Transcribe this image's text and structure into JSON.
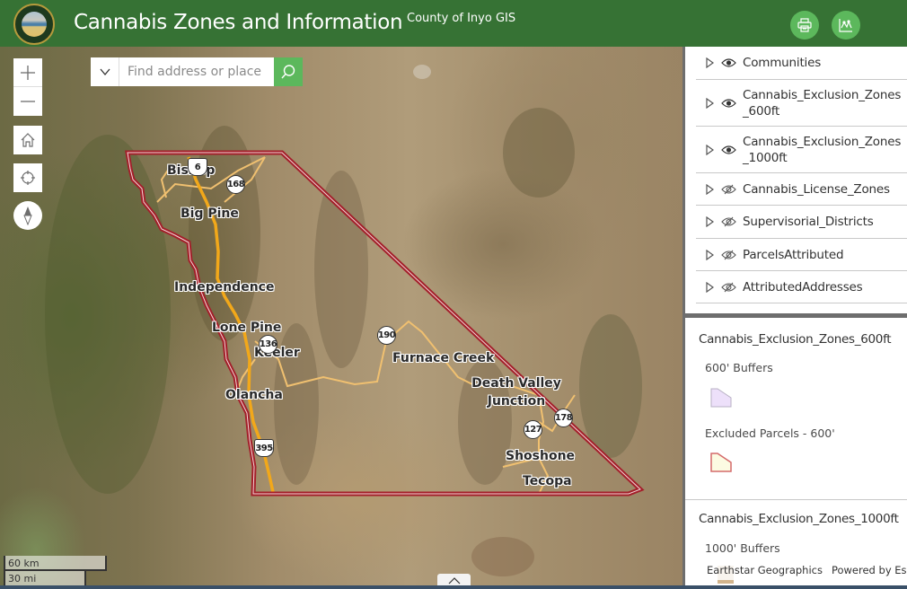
{
  "header": {
    "title": "Cannabis Zones and Information",
    "subtitle": "County of Inyo GIS",
    "logo_alt": "County of Inyo seal",
    "buttons": [
      {
        "name": "print",
        "icon": "printer-icon"
      },
      {
        "name": "chart",
        "icon": "line-chart-icon"
      }
    ],
    "color": "#367234",
    "button_color": "#5cb85c"
  },
  "search": {
    "placeholder": "Find address or place",
    "value": "",
    "dropdown_icon": "chevron-down-icon",
    "button_icon": "search-icon"
  },
  "map_controls": {
    "zoom_in": "+",
    "zoom_out": "−",
    "home_icon": "home-icon",
    "locate_icon": "crosshair-icon",
    "compass_icon": "compass-icon"
  },
  "map": {
    "basemap": "Imagery",
    "boundary_color": "#a31f2a",
    "highway_color": "#f2a81a",
    "road_color": "#f0c070",
    "places": [
      {
        "name": "Bishop"
      },
      {
        "name": "Big Pine"
      },
      {
        "name": "Independence"
      },
      {
        "name": "Lone Pine"
      },
      {
        "name": "Keeler"
      },
      {
        "name": "Olancha"
      },
      {
        "name": "Furnace Creek"
      },
      {
        "name": "Death Valley Junction"
      },
      {
        "name": "Shoshone"
      },
      {
        "name": "Tecopa"
      }
    ],
    "route_shields": [
      {
        "route": "6",
        "type": "us"
      },
      {
        "route": "168",
        "type": "state"
      },
      {
        "route": "136",
        "type": "state"
      },
      {
        "route": "190",
        "type": "state"
      },
      {
        "route": "395",
        "type": "us"
      },
      {
        "route": "127",
        "type": "state"
      },
      {
        "route": "178",
        "type": "state"
      }
    ],
    "scalebar": {
      "metric": "60 km",
      "imperial": "30 mi"
    },
    "collapse_icon": "chevron-up-icon"
  },
  "layer_list": {
    "items": [
      {
        "label": "Communities",
        "visible": true
      },
      {
        "label": "Cannabis_Exclusion_Zones_600ft",
        "visible": true
      },
      {
        "label": "Cannabis_Exclusion_Zones_1000ft",
        "visible": true
      },
      {
        "label": "Cannabis_License_Zones",
        "visible": false
      },
      {
        "label": "Supervisorial_Districts",
        "visible": false
      },
      {
        "label": "ParcelsAttributed",
        "visible": false
      },
      {
        "label": "AttributedAddresses",
        "visible": false
      }
    ]
  },
  "legend": {
    "sections": [
      {
        "title": "Cannabis_Exclusion_Zones_600ft",
        "entries": [
          {
            "label": "600' Buffers",
            "fill": "#ede0fa",
            "stroke": "#b8b0c4"
          },
          {
            "label": "Excluded Parcels - 600'",
            "fill": "#fcfbe2",
            "stroke": "#d46a6a"
          }
        ]
      },
      {
        "title": "Cannabis_Exclusion_Zones_1000ft",
        "entries": [
          {
            "label": "1000' Buffers",
            "fill": "#d2b48c",
            "stroke": "#d2b48c"
          }
        ]
      }
    ]
  },
  "attribution": {
    "source": "Earthstar Geographics",
    "powered": "Powered by Esri"
  }
}
